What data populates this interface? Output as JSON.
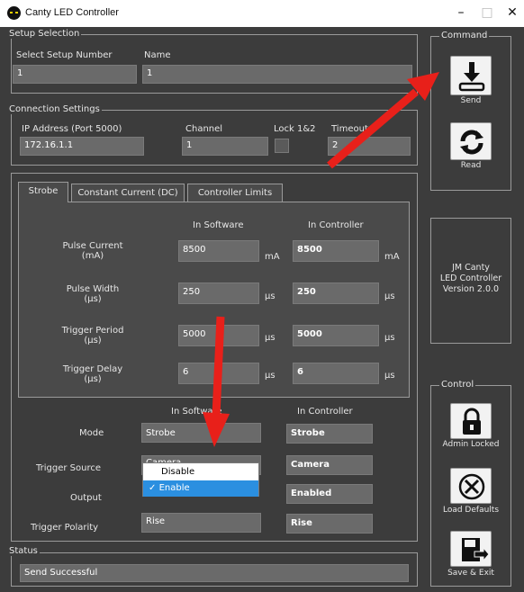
{
  "window": {
    "title": "Canty LED Controller",
    "min_glyph": "–",
    "max_glyph": "□",
    "close_glyph": "✕"
  },
  "setup": {
    "legend": "Setup Selection",
    "number_label": "Select Setup Number",
    "number_value": "1",
    "name_label": "Name",
    "name_value": "1"
  },
  "connection": {
    "legend": "Connection Settings",
    "ip_label": "IP Address (Port 5000)",
    "ip_value": "172.16.1.1",
    "channel_label": "Channel",
    "channel_value": "1",
    "lock_label": "Lock 1&2",
    "timeout_label": "Timeout",
    "timeout_value": "2"
  },
  "tabs": [
    "Strobe",
    "Constant Current (DC)",
    "Controller Limits"
  ],
  "strobe": {
    "col_software": "In Software",
    "col_controller": "In Controller",
    "rows": [
      {
        "label1": "Pulse Current",
        "label2": "(mA)",
        "software": "8500",
        "controller": "8500",
        "unit": "mA"
      },
      {
        "label1": "Pulse Width",
        "label2": "(µs)",
        "software": "250",
        "controller": "250",
        "unit": "µs"
      },
      {
        "label1": "Trigger Period",
        "label2": "(µs)",
        "software": "5000",
        "controller": "5000",
        "unit": "µs"
      },
      {
        "label1": "Trigger Delay",
        "label2": "(µs)",
        "software": "6",
        "controller": "6",
        "unit": "µs"
      }
    ]
  },
  "lower": {
    "col_software": "In Software",
    "col_controller": "In Controller",
    "mode_label": "Mode",
    "mode_software": "Strobe",
    "mode_controller": "Strobe",
    "trigger_source_label": "Trigger Source",
    "trigger_source_software": "Camera",
    "trigger_source_controller": "Camera",
    "output_label": "Output",
    "output_controller": "Enabled",
    "polarity_label": "Trigger Polarity",
    "polarity_software": "Rise",
    "polarity_controller": "Rise"
  },
  "output_dropdown": {
    "options": [
      "Disable",
      "Enable"
    ],
    "selected": "Enable",
    "check": "✓"
  },
  "command": {
    "legend": "Command",
    "send_label": "Send",
    "read_label": "Read"
  },
  "info": {
    "line1": "JM Canty",
    "line2": "LED Controller",
    "line3": "Version 2.0.0"
  },
  "control": {
    "legend": "Control",
    "admin_label": "Admin Locked",
    "defaults_label": "Load Defaults",
    "exit_label": "Save & Exit"
  },
  "status": {
    "legend": "Status",
    "text": "Send Successful"
  },
  "colors": {
    "background": "#3c3c3c",
    "panel": "#4a4a4a",
    "field": "#6a6a6a",
    "annotation_arrow": "#e8201a",
    "selection": "#2b8fe0"
  }
}
